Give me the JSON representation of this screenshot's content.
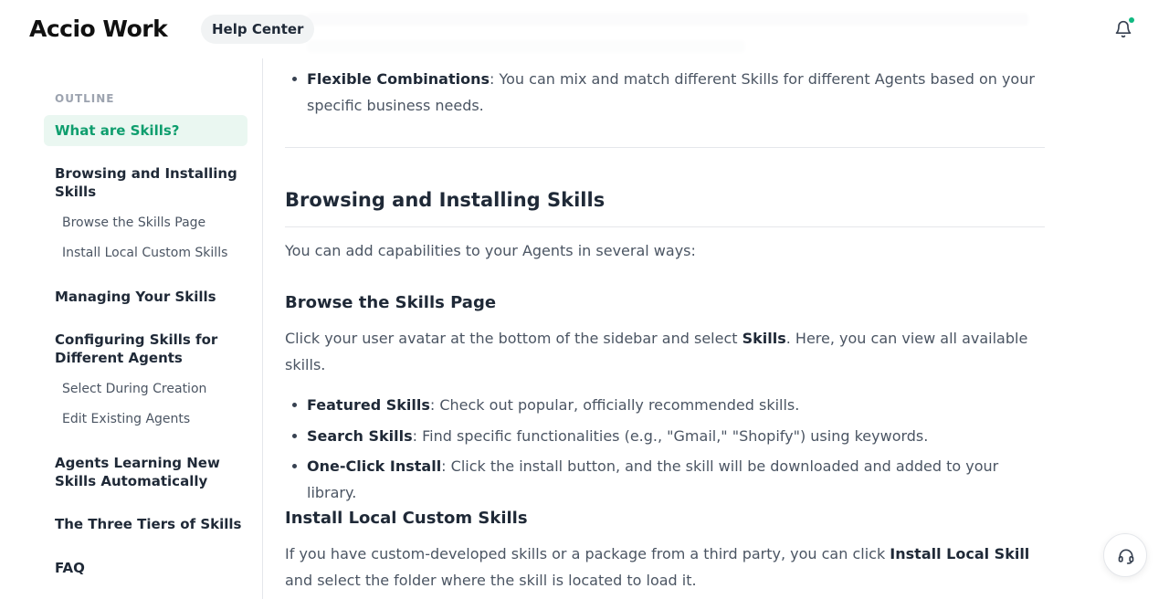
{
  "header": {
    "logo": "Accio Work",
    "help_center": "Help Center"
  },
  "ghost": {
    "line1": "(obscured text)",
    "line2": "(obscured text)"
  },
  "sidebar": {
    "outline_title": "OUTLINE",
    "items": [
      {
        "label": "What are Skills?"
      },
      {
        "label": "Browsing and Installing Skills"
      },
      {
        "label": "Browse the Skills Page"
      },
      {
        "label": "Install Local Custom Skills"
      },
      {
        "label": "Managing Your Skills"
      },
      {
        "label": "Configuring Skills for Different Agents"
      },
      {
        "label": "Select During Creation"
      },
      {
        "label": "Edit Existing Agents"
      },
      {
        "label": "Agents Learning New Skills Automatically"
      },
      {
        "label": "The Three Tiers of Skills"
      },
      {
        "label": "FAQ"
      }
    ]
  },
  "content": {
    "flex_bold": "Flexible Combinations",
    "flex_text": ": You can mix and match different Skills for different Agents based on your specific business needs.",
    "h2_browsing": "Browsing and Installing Skills",
    "intro": "You can add capabilities to your Agents in several ways:",
    "h3_browse": "Browse the Skills Page",
    "browse_pre": "Click your user avatar at the bottom of the sidebar and select ",
    "browse_bold": "Skills",
    "browse_post": ". Here, you can view all available skills.",
    "bullets": [
      {
        "bold": "Featured Skills",
        "text": ": Check out popular, officially recommended skills."
      },
      {
        "bold": "Search Skills",
        "text": ": Find specific functionalities (e.g., \"Gmail,\" \"Shopify\") using keywords."
      },
      {
        "bold": "One-Click Install",
        "text": ": Click the install button, and the skill will be downloaded and added to your library."
      }
    ],
    "h3_local": "Install Local Custom Skills",
    "local_pre": "If you have custom-developed skills or a package from a third party, you can click ",
    "local_bold": "Install Local Skill",
    "local_post": " and select the folder where the skill is located to load it."
  },
  "icons": {
    "bell": "bell-icon",
    "support": "headset-icon"
  },
  "colors": {
    "accent": "#0f9e6e",
    "active_bg": "#eaf7f1",
    "notification_dot": "#10b981"
  }
}
